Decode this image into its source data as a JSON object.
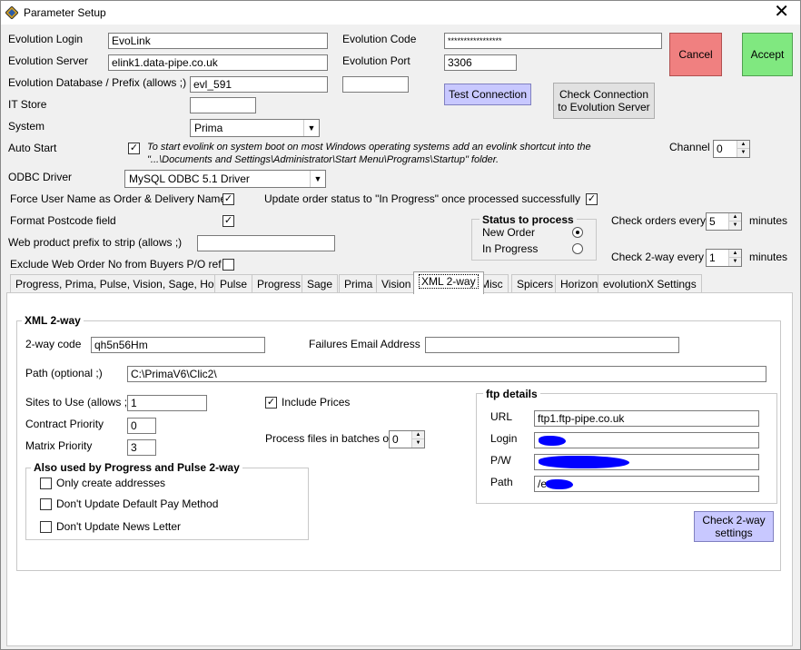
{
  "window": {
    "title": "Parameter Setup"
  },
  "top": {
    "login_label": "Evolution Login",
    "login_value": "EvoLink",
    "server_label": "Evolution Server",
    "server_value": "elink1.data-pipe.co.uk",
    "db_label": "Evolution Database / Prefix  (allows ;)",
    "db_value": "evl_591",
    "db_prefix_value": "",
    "code_label": "Evolution Code",
    "code_value": "*****************",
    "port_label": "Evolution Port",
    "port_value": "3306",
    "itstore_label": "IT Store",
    "itstore_value": "",
    "system_label": "System",
    "system_value": "Prima",
    "autostart_label": "Auto Start",
    "autostart_info": "To start evolink on system boot on most Windows operating systems add an evolink shortcut into the \"...\\Documents and Settings\\Administrator\\Start Menu\\Programs\\Startup\" folder.",
    "odbc_label": "ODBC Driver",
    "odbc_value": "MySQL ODBC 5.1 Driver",
    "force_user_label": "Force User Name as Order & Delivery Name",
    "update_status_label": "Update order status to \"In Progress\"  once processed successfully",
    "format_postcode_label": "Format Postcode field",
    "web_prefix_label": "Web product prefix to strip (allows ;)",
    "web_prefix_value": "",
    "exclude_label": "Exclude Web Order No from Buyers P/O ref",
    "channel_label": "Channel",
    "channel_value": "0",
    "check_orders_label": "Check orders every",
    "check_orders_value": "5",
    "check_2way_label": "Check 2-way every",
    "check_2way_value": "1",
    "minutes1": "minutes",
    "minutes2": "minutes"
  },
  "buttons": {
    "cancel": "Cancel",
    "accept": "Accept",
    "test_connection": "Test Connection",
    "check_connection": "Check Connection to Evolution Server",
    "check_2way": "Check 2-way settings"
  },
  "status": {
    "title": "Status to process",
    "new_order": "New Order",
    "in_progress": "In Progress"
  },
  "tabs": [
    "Progress, Prima, Pulse, Vision, Sage, Horizon",
    "Pulse",
    "Progress",
    "Sage",
    "Prima",
    "Vision",
    "XML 2-way",
    "Misc",
    "Spicers",
    "Horizon",
    "evolutionX Settings"
  ],
  "xml": {
    "group_title": "XML 2-way",
    "code_label": "2-way code",
    "code_value": "qh5n56Hm",
    "failures_label": "Failures Email Address",
    "failures_value": "",
    "path_label": "Path (optional ;)",
    "path_value": "C:\\PrimaV6\\Clic2\\",
    "sites_label": "Sites to Use (allows ;)",
    "sites_value": "1",
    "contract_label": "Contract Priority",
    "contract_value": "0",
    "matrix_label": "Matrix Priority",
    "matrix_value": "3",
    "include_prices_label": "Include Prices",
    "batches_label": "Process files in batches of",
    "batches_value": "0",
    "also_title": "Also used by Progress and Pulse 2-way",
    "only_addresses_label": "Only create addresses",
    "no_pay_label": "Don't Update Default Pay Method",
    "no_news_label": "Don't Update News Letter"
  },
  "ftp": {
    "title": "ftp details",
    "url_label": "URL",
    "url_value": "ftp1.ftp-pipe.co.uk",
    "login_label": "Login",
    "pw_label": "P/W",
    "path_label": "Path",
    "path_value": "/e"
  },
  "colors": {
    "cancel_bg": "#f08080",
    "accept_bg": "#80e880",
    "highlight_btn": "#c8c8ff",
    "redaction": "#0000ff"
  }
}
